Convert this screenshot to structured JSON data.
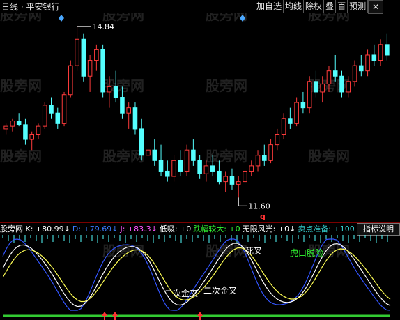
{
  "header": {
    "title": "日线 · 平安银行",
    "toolbar": [
      "加自选",
      "均线",
      "除权",
      "叠",
      "百",
      "预测"
    ],
    "close": "✕"
  },
  "watermark": "股旁网",
  "price_panel": {
    "high_label": "14.84",
    "low_label": "11.60",
    "marker": "q",
    "candles": [
      [
        12.9,
        13.0,
        12.8,
        12.95
      ],
      [
        12.95,
        13.1,
        12.85,
        13.05
      ],
      [
        13.05,
        13.2,
        12.95,
        12.98
      ],
      [
        12.98,
        13.1,
        12.6,
        12.7
      ],
      [
        12.7,
        12.85,
        12.5,
        12.8
      ],
      [
        12.8,
        13.0,
        12.7,
        12.95
      ],
      [
        12.95,
        13.4,
        12.9,
        13.35
      ],
      [
        13.35,
        13.5,
        13.1,
        13.2
      ],
      [
        13.2,
        13.3,
        12.9,
        13.0
      ],
      [
        13.0,
        13.6,
        12.95,
        13.55
      ],
      [
        13.55,
        14.2,
        13.5,
        14.1
      ],
      [
        14.1,
        14.84,
        14.0,
        14.6
      ],
      [
        14.6,
        14.7,
        13.8,
        13.9
      ],
      [
        13.9,
        14.3,
        13.6,
        14.2
      ],
      [
        14.2,
        14.5,
        14.0,
        14.4
      ],
      [
        14.4,
        14.5,
        13.5,
        13.6
      ],
      [
        13.6,
        13.9,
        13.3,
        13.7
      ],
      [
        13.7,
        14.0,
        13.4,
        13.5
      ],
      [
        13.5,
        13.7,
        13.1,
        13.2
      ],
      [
        13.2,
        13.4,
        12.9,
        13.3
      ],
      [
        13.3,
        13.4,
        12.8,
        12.9
      ],
      [
        12.9,
        13.1,
        12.3,
        12.4
      ],
      [
        12.4,
        12.6,
        12.1,
        12.5
      ],
      [
        12.5,
        12.7,
        12.2,
        12.3
      ],
      [
        12.3,
        12.6,
        12.0,
        12.1
      ],
      [
        12.1,
        12.3,
        11.9,
        12.0
      ],
      [
        12.0,
        12.4,
        11.9,
        12.3
      ],
      [
        12.3,
        12.5,
        12.0,
        12.1
      ],
      [
        12.1,
        12.6,
        12.0,
        12.5
      ],
      [
        12.5,
        12.7,
        12.2,
        12.3
      ],
      [
        12.3,
        12.4,
        11.95,
        12.05
      ],
      [
        12.05,
        12.3,
        11.9,
        12.2
      ],
      [
        12.2,
        12.4,
        12.0,
        12.1
      ],
      [
        12.1,
        12.3,
        11.85,
        11.9
      ],
      [
        11.9,
        12.1,
        11.7,
        12.0
      ],
      [
        12.0,
        12.15,
        11.75,
        11.85
      ],
      [
        11.85,
        12.0,
        11.6,
        11.9
      ],
      [
        11.9,
        12.2,
        11.8,
        12.1
      ],
      [
        12.1,
        12.3,
        12.0,
        12.2
      ],
      [
        12.2,
        12.5,
        12.1,
        12.4
      ],
      [
        12.4,
        12.6,
        12.2,
        12.3
      ],
      [
        12.3,
        12.7,
        12.25,
        12.6
      ],
      [
        12.6,
        12.9,
        12.5,
        12.8
      ],
      [
        12.8,
        13.2,
        12.7,
        13.1
      ],
      [
        13.1,
        13.3,
        12.9,
        13.0
      ],
      [
        13.0,
        13.5,
        12.95,
        13.4
      ],
      [
        13.4,
        13.6,
        13.2,
        13.3
      ],
      [
        13.3,
        13.9,
        13.2,
        13.8
      ],
      [
        13.8,
        14.0,
        13.5,
        13.6
      ],
      [
        13.6,
        13.9,
        13.4,
        13.75
      ],
      [
        13.75,
        14.1,
        13.6,
        14.0
      ],
      [
        14.0,
        14.3,
        13.8,
        13.9
      ],
      [
        13.9,
        14.0,
        13.5,
        13.6
      ],
      [
        13.6,
        13.9,
        13.5,
        13.8
      ],
      [
        13.8,
        14.2,
        13.7,
        14.1
      ],
      [
        14.1,
        14.3,
        13.9,
        14.0
      ],
      [
        14.0,
        14.4,
        13.9,
        14.3
      ],
      [
        14.3,
        14.5,
        14.1,
        14.2
      ],
      [
        14.2,
        14.6,
        14.1,
        14.5
      ],
      [
        14.5,
        14.7,
        14.2,
        14.3
      ]
    ]
  },
  "indicator_bar": {
    "items": [
      {
        "text": "股旁网 K: +80.99↓",
        "color": "#ffffff"
      },
      {
        "text": "D: +79.69↓",
        "color": "#3b7bff"
      },
      {
        "text": "J: +83.3↓",
        "color": "#ff55ff"
      },
      {
        "text": "低吸: +0",
        "color": "#ffffff"
      },
      {
        "text": "跌幅较大: +0",
        "color": "#33ff33"
      },
      {
        "text": "无限风光: +0↓",
        "color": "#ffffff"
      },
      {
        "text": "卖点准备: +100",
        "color": "#33cccc"
      }
    ],
    "guide_button": "指标说明"
  },
  "annotations": {
    "dead_cross": "死叉",
    "tiger_escape": "虎口脱险",
    "second_gold_1": "二次金叉",
    "second_gold_2": "二次金叉"
  },
  "colors": {
    "up": "#ff3b3b",
    "down": "#54ffff",
    "k_line": "#ffffff",
    "d_line": "#ffff55",
    "j_line": "#3355ff"
  }
}
